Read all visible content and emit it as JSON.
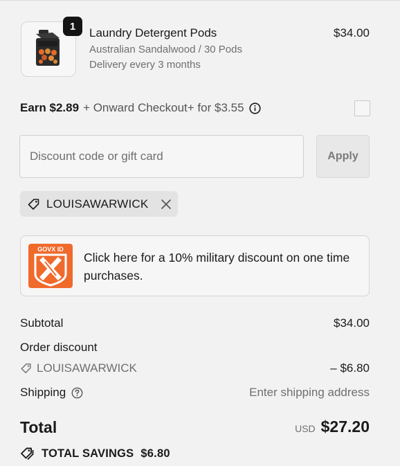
{
  "product": {
    "quantity": "1",
    "title": "Laundry Detergent Pods",
    "variant": "Australian Sandalwood / 30 Pods",
    "delivery": "Delivery every 3 months",
    "price": "$34.00",
    "image_icon": "detergent-pods-box-icon"
  },
  "earn": {
    "strong": "Earn $2.89",
    "rest": "+ Onward Checkout+ for $3.55",
    "info_icon": "info-circle-icon",
    "checked": false
  },
  "discount": {
    "placeholder": "Discount code or gift card",
    "value": "",
    "apply_label": "Apply"
  },
  "applied_code": {
    "code": "LOUISAWARWICK",
    "tag_icon": "tag-icon",
    "remove_icon": "close-icon"
  },
  "military_banner": {
    "logo_text": "GOVX ID",
    "logo_icon": "govx-shield-icon",
    "text": "Click here for a 10% military discount on one time purchases.",
    "accent_color": "#f06a2c"
  },
  "summary": {
    "subtotal_label": "Subtotal",
    "subtotal_value": "$34.00",
    "order_discount_label": "Order discount",
    "discount_code": "LOUISAWARWICK",
    "discount_value": "– $6.80",
    "shipping_label": "Shipping",
    "shipping_value": "Enter shipping address",
    "total_label": "Total",
    "total_currency": "USD",
    "total_value": "$27.20",
    "savings_label": "TOTAL SAVINGS",
    "savings_value": "$6.80"
  }
}
